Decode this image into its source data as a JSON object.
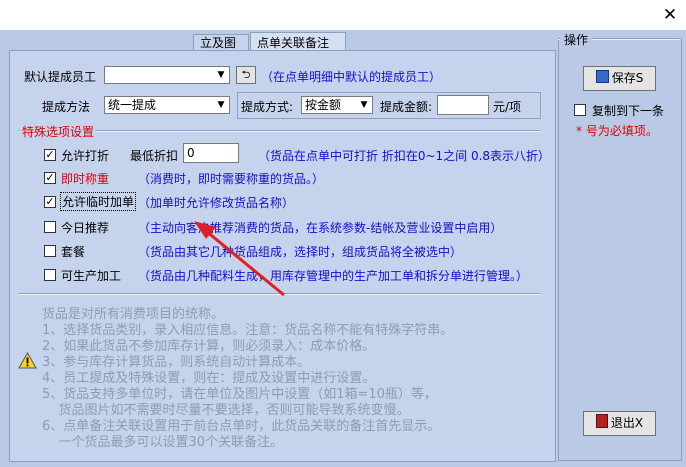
{
  "window": {
    "close_glyph": "✕"
  },
  "tabs": [
    {
      "label": "立及图片"
    },
    {
      "label": "点单关联备注"
    }
  ],
  "form": {
    "default_staff_label": "默认提成员工",
    "default_staff_value": "",
    "default_staff_hint": "（在点单明细中默认的提成员工）",
    "commission_method_label": "提成方法",
    "commission_method_value": "统一提成",
    "commission_mode_label": "提成方式:",
    "commission_mode_value": "按金额",
    "commission_amount_label": "提成金额:",
    "commission_amount_value": "",
    "commission_unit": "元/项"
  },
  "special": {
    "title": "特殊选项设置",
    "allow_discount_label": "允许打折",
    "allow_discount_checked": true,
    "min_discount_label": "最低折扣",
    "min_discount_value": "0",
    "allow_discount_hint": "（货品在点单中可打折  折扣在0~1之间  0.8表示八折）",
    "weigh_label": "即时称重",
    "weigh_checked": true,
    "weigh_hint": "（消费时，即时需要称重的货品。）",
    "temp_add_label": "允许临时加单",
    "temp_add_checked": true,
    "temp_add_hint": "（加单时允许修改货品名称）",
    "recommend_label": "今日推荐",
    "recommend_checked": false,
    "recommend_hint": "（主动向客户推荐消费的货品，在系统参数-结帐及营业设置中启用）",
    "combo_label": "套餐",
    "combo_checked": false,
    "combo_hint": "（货品由其它几种货品组成，选择时，组成货品将全被选中）",
    "production_label": "可生产加工",
    "production_checked": false,
    "production_hint": "（货品由几种配料生成，用库存管理中的生产加工单和拆分单进行管理。）"
  },
  "notes": {
    "icon": "warning-icon",
    "lines": [
      "货品是对所有消费项目的统称。",
      "1、选择货品类别，录入相应信息。注意：货品名称不能有特殊字符串。",
      "2、如果此货品不参加库存计算，则必须录入：成本价格。",
      "3、参与库存计算货品，则系统自动计算成本。",
      "4、员工提成及特殊设置，则在：提成及设置中进行设置。",
      "5、货品支持多单位时，请在单位及图片中设置（如1箱=10瓶）等，",
      "    货品图片如不需要时尽量不要选择，否则可能导致系统变慢。",
      "6、点单备注关联设置用于前台点单时，此货品关联的备注首先显示。",
      "    一个货品最多可以设置30个关联备注。"
    ]
  },
  "side": {
    "group_title": "操作",
    "save_label": "保存S",
    "copy_next_label": "复制到下一条",
    "copy_next_checked": false,
    "required_note": "* 号为必填项。",
    "exit_label": "退出X"
  },
  "colors": {
    "accent_red": "#e00000",
    "hint_blue": "#1010d0",
    "panel": "#c5d3ec"
  }
}
